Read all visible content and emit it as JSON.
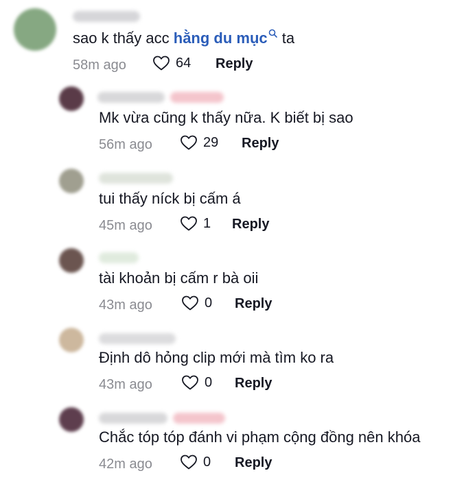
{
  "comments": [
    {
      "text_prefix": "sao k thấy acc ",
      "mention": "hằng du mục",
      "text_suffix": " ta",
      "time": "58m ago",
      "likes": "64",
      "reply_label": "Reply",
      "avatar_color": "#7fa37a"
    },
    {
      "text": "Mk vừa cũng k thấy nữa. K biết bị sao",
      "time": "56m ago",
      "likes": "29",
      "reply_label": "Reply",
      "avatar_color": "#5a3b48"
    },
    {
      "text": "tui thấy níck bị cấm á",
      "time": "45m ago",
      "likes": "1",
      "reply_label": "Reply",
      "avatar_color": "#9a9a8a"
    },
    {
      "text": "tài khoản bị cấm r bà oii",
      "time": "43m ago",
      "likes": "0",
      "reply_label": "Reply",
      "avatar_color": "#6b5550"
    },
    {
      "text": "Định dô hỏng clip mới mà tìm ko ra",
      "time": "43m ago",
      "likes": "0",
      "reply_label": "Reply",
      "avatar_color": "#c9b49a"
    },
    {
      "text": "Chắc tóp tóp đánh vi phạm cộng đồng nên khóa",
      "time": "42m ago",
      "likes": "0",
      "reply_label": "Reply",
      "avatar_color": "#5e3e4e"
    }
  ],
  "icons": {
    "like": "heart-outline-icon",
    "mention": "search-icon"
  }
}
